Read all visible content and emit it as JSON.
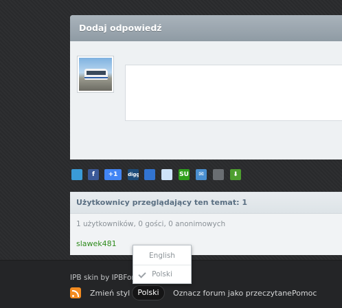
{
  "reply": {
    "header": "Dodaj odpowiedź"
  },
  "share": {
    "icons": [
      {
        "name": "twitter-icon",
        "color": "#3a9bd8",
        "label": ""
      },
      {
        "name": "facebook-icon",
        "color": "#3b5998",
        "label": "f"
      },
      {
        "name": "google-plus-one-icon",
        "color": "#4285f4",
        "label": "+1"
      },
      {
        "name": "digg-icon",
        "color": "#1d4c7a",
        "label": "digg"
      },
      {
        "name": "delicious-icon",
        "color": "#3274d1",
        "label": ""
      },
      {
        "name": "reddit-icon",
        "color": "#cee3f8",
        "label": ""
      },
      {
        "name": "stumbleupon-icon",
        "color": "#2fa01c",
        "label": "SU"
      },
      {
        "name": "email-icon",
        "color": "#4a8fd0",
        "label": "✉"
      },
      {
        "name": "print-icon",
        "color": "#6a6e72",
        "label": ""
      },
      {
        "name": "download-icon",
        "color": "#4e9f2f",
        "label": "⬇"
      }
    ]
  },
  "viewers": {
    "title": "Użytkownicy przeglądający ten temat: 1",
    "counts": "1 użytkowników, 0 gości, 0 anonimowych",
    "user": "slawek481"
  },
  "footer": {
    "skin_credit": "IPB skin by IPBForu",
    "change_style": "Zmień styl",
    "language": "Polski",
    "mark_read": "Oznacz forum jako przeczytane",
    "help": "Pomoc"
  },
  "language_menu": {
    "options": [
      "English",
      "Polski"
    ],
    "selected": "Polski"
  }
}
